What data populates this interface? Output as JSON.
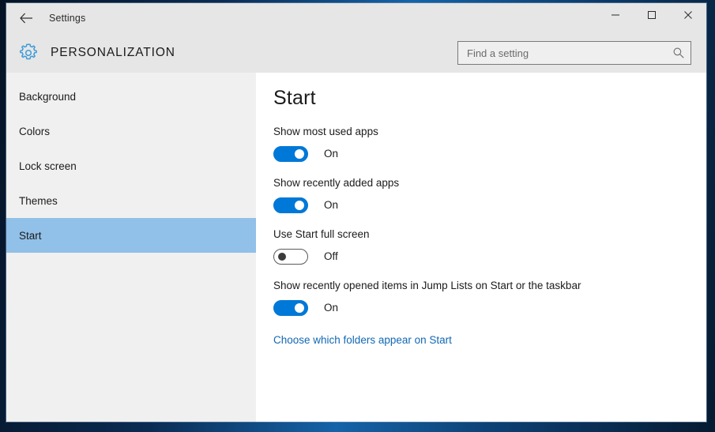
{
  "window": {
    "titlebar": {
      "back_icon": "back-arrow-icon",
      "app_title": "Settings",
      "minimize_label": "─",
      "maximize_label": "☐",
      "close_label": "✕"
    },
    "header": {
      "gear_icon": "gear-icon",
      "category_title": "PERSONALIZATION",
      "search": {
        "value": "",
        "placeholder": "Find a setting",
        "icon": "search-icon"
      }
    }
  },
  "sidebar": {
    "items": [
      {
        "label": "Background",
        "selected": false
      },
      {
        "label": "Colors",
        "selected": false
      },
      {
        "label": "Lock screen",
        "selected": false
      },
      {
        "label": "Themes",
        "selected": false
      },
      {
        "label": "Start",
        "selected": true
      }
    ]
  },
  "main": {
    "page_title": "Start",
    "settings": [
      {
        "label": "Show most used apps",
        "state": "On",
        "on": true
      },
      {
        "label": "Show recently added apps",
        "state": "On",
        "on": true
      },
      {
        "label": "Use Start full screen",
        "state": "Off",
        "on": false
      },
      {
        "label": "Show recently opened items in Jump Lists on Start or the taskbar",
        "state": "On",
        "on": true
      }
    ],
    "link": "Choose which folders appear on Start"
  },
  "colors": {
    "accent_blue": "#0078d7",
    "selection_blue": "#91c0e8",
    "link_blue": "#1168b4",
    "chrome_gray": "#e6e6e6",
    "sidebar_gray": "#f0f0f0"
  }
}
